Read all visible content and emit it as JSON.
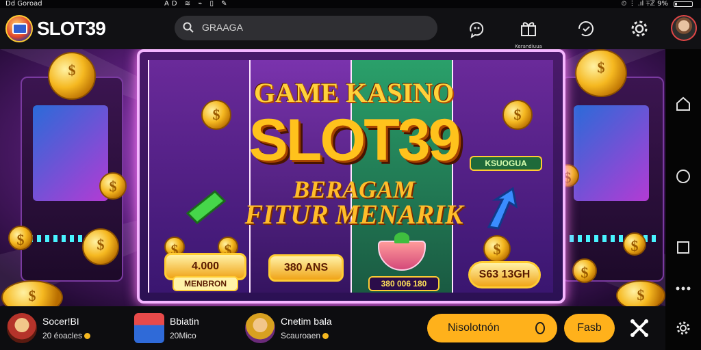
{
  "status_bar": {
    "left_text": "Dd Goroad",
    "mid_text": "AD  ≋  ⌁  ▯  ✎",
    "right_text": "⏲  ⋮  .ıl  ⏇ℤ  9%"
  },
  "app": {
    "logo_text": "SLOT39",
    "search_placeholder": "GRAAGA",
    "top_icons": [
      {
        "icon": "refresh-chat-icon",
        "label": ""
      },
      {
        "icon": "gift-icon",
        "label": "Kerandiuua"
      },
      {
        "icon": "rotate-shield-icon",
        "label": ""
      },
      {
        "icon": "gear-icon",
        "label": ""
      }
    ],
    "avatar": "user-avatar"
  },
  "banner": {
    "title_top": "GAME KASINO",
    "title_main": "SLOT39",
    "subtitle_1": "BERAGAM",
    "subtitle_2": "FITUR MENARIK",
    "badge_right": "KSUOGUA",
    "prize_1": "4.000",
    "prize_1_label": "MENBRON",
    "prize_2": "380 ANS",
    "prize_3": "380 006 180",
    "prize_4": "S63 13GH"
  },
  "bottom_bar": {
    "items": [
      {
        "icon": "warrior-avatar-icon",
        "title": "Socer!BI",
        "subtitle": "20 éoacles"
      },
      {
        "icon": "shop-icon",
        "title": "Bbiatin",
        "subtitle": "20Mico"
      },
      {
        "icon": "character-avatar-icon",
        "title": "Cnetim bala",
        "subtitle": "Scauroaen"
      }
    ],
    "primary_button": "Nisolotnón",
    "secondary_button": "Fasb"
  },
  "nav_rail": [
    "home-icon",
    "circle-home-icon",
    "square-recents-icon",
    "more-vert-icon",
    "settings-gear-icon"
  ],
  "colors": {
    "accent": "#ffb11b",
    "brand_orange": "#ff9a1f",
    "background": "#111114"
  }
}
